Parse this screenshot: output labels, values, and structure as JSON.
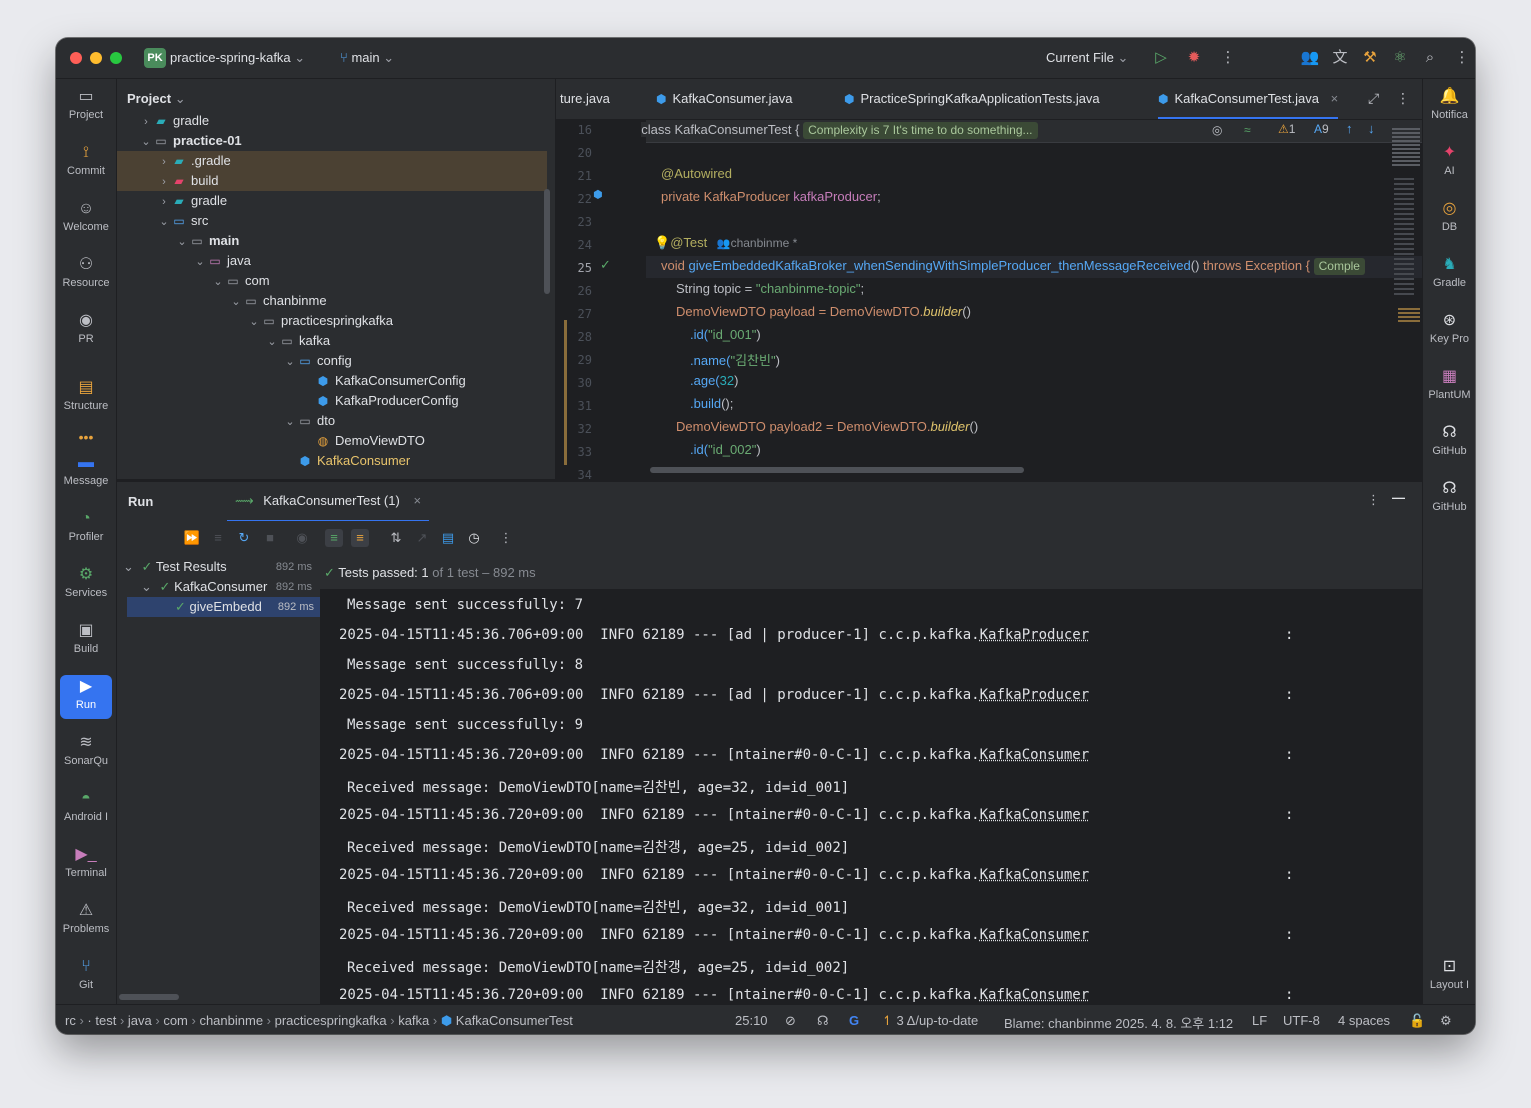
{
  "titlebar": {
    "project_badge": "PK",
    "project_name": "practice-spring-kafka",
    "branch": "main",
    "run_config": "Current File",
    "colors": {
      "close": "#ff5f57",
      "minimize": "#febc2e",
      "zoom": "#28c840"
    }
  },
  "left_tools": [
    {
      "label": "Project",
      "icon": "laptop-icon"
    },
    {
      "label": "Commit",
      "icon": "commit-icon"
    },
    {
      "label": "Welcome",
      "icon": "welcome-icon"
    },
    {
      "label": "Resource",
      "icon": "resource-icon"
    },
    {
      "label": "PR",
      "icon": "github-icon"
    },
    {
      "label": "Structure",
      "icon": "structure-icon"
    },
    {
      "label": "Message",
      "icon": "message-icon"
    },
    {
      "label": "Profiler",
      "icon": "profiler-icon"
    },
    {
      "label": "Services",
      "icon": "services-icon"
    },
    {
      "label": "Build",
      "icon": "build-icon"
    },
    {
      "label": "Run",
      "icon": "run-icon"
    },
    {
      "label": "SonarQu",
      "icon": "sonar-icon"
    },
    {
      "label": "Android I",
      "icon": "android-icon"
    },
    {
      "label": "Terminal",
      "icon": "terminal-icon"
    },
    {
      "label": "Problems",
      "icon": "problems-icon"
    },
    {
      "label": "Git",
      "icon": "git-icon"
    }
  ],
  "right_tools": [
    {
      "label": "Notifica",
      "icon": "bell-icon"
    },
    {
      "label": "AI",
      "icon": "ai-icon"
    },
    {
      "label": "DB",
      "icon": "database-icon"
    },
    {
      "label": "Gradle",
      "icon": "gradle-icon"
    },
    {
      "label": "Key Pro",
      "icon": "key-promoter-icon"
    },
    {
      "label": "PlantUM",
      "icon": "plantuml-icon"
    },
    {
      "label": "GitHub",
      "icon": "copilot-icon"
    },
    {
      "label": "GitHub",
      "icon": "copilot-chat-icon"
    },
    {
      "label": "Layout I",
      "icon": "layout-inspector-icon"
    }
  ],
  "project_panel": {
    "title": "Project",
    "tree": [
      {
        "label": "gradle",
        "depth": 1,
        "chev": "›",
        "icon": "gradle-folder-icon"
      },
      {
        "label": "practice-01",
        "depth": 1,
        "chev": "⌄",
        "icon": "folder-icon",
        "bold": true
      },
      {
        "label": ".gradle",
        "depth": 2,
        "chev": "›",
        "icon": "gradle-folder-icon",
        "selected": true
      },
      {
        "label": "build",
        "depth": 2,
        "chev": "›",
        "icon": "excluded-folder-icon",
        "selected": true
      },
      {
        "label": "gradle",
        "depth": 2,
        "chev": "›",
        "icon": "gradle-folder-icon"
      },
      {
        "label": "src",
        "depth": 2,
        "chev": "⌄",
        "icon": "source-folder-icon"
      },
      {
        "label": "main",
        "depth": 3,
        "chev": "⌄",
        "icon": "module-folder-icon",
        "bold": true
      },
      {
        "label": "java",
        "depth": 4,
        "chev": "⌄",
        "icon": "java-folder-icon"
      },
      {
        "label": "com",
        "depth": 5,
        "chev": "⌄",
        "icon": "folder-icon"
      },
      {
        "label": "chanbinme",
        "depth": 6,
        "chev": "⌄",
        "icon": "folder-icon"
      },
      {
        "label": "practicespringkafka",
        "depth": 7,
        "chev": "⌄",
        "icon": "folder-icon"
      },
      {
        "label": "kafka",
        "depth": 8,
        "chev": "⌄",
        "icon": "folder-icon"
      },
      {
        "label": "config",
        "depth": 9,
        "chev": "⌄",
        "icon": "config-folder-icon"
      },
      {
        "label": "KafkaConsumerConfig",
        "depth": 10,
        "chev": "",
        "icon": "java-class-icon"
      },
      {
        "label": "KafkaProducerConfig",
        "depth": 10,
        "chev": "",
        "icon": "java-class-icon"
      },
      {
        "label": "dto",
        "depth": 9,
        "chev": "⌄",
        "icon": "package-icon"
      },
      {
        "label": "DemoViewDTO",
        "depth": 10,
        "chev": "",
        "icon": "record-icon"
      },
      {
        "label": "KafkaConsumer",
        "depth": 9,
        "chev": "",
        "icon": "java-class-icon",
        "accent": true
      }
    ]
  },
  "editor_tabs": [
    {
      "label": "ture.java",
      "active": false
    },
    {
      "label": "KafkaConsumer.java",
      "active": false
    },
    {
      "label": "PracticeSpringKafkaApplicationTests.java",
      "active": false
    },
    {
      "label": "KafkaConsumerTest.java",
      "active": true
    }
  ],
  "editor": {
    "sticky_line_number": "16",
    "sticky_code": "class KafkaConsumerTest {",
    "sticky_hint": "Complexity is 7 It's time to do something...",
    "warnings": "1",
    "typos": "9",
    "line_numbers": [
      "20",
      "21",
      "22",
      "23",
      "24",
      "25",
      "26",
      "27",
      "28",
      "29",
      "30",
      "31",
      "32",
      "33",
      "34"
    ],
    "current_line": "25",
    "author_hint": "chanbinme *",
    "code": {
      "l21": "@Autowired",
      "l22_kw": "private",
      "l22_type": "KafkaProducer",
      "l22_field": "kafkaProducer",
      "l22_end": ";",
      "l24": "@Test",
      "l25_kw": "void",
      "l25_fn": "giveEmbeddedKafkaBroker_whenSendingWithSimpleProducer_thenMessageReceived",
      "l25_mid": "()",
      "l25_throws": "throws",
      "l25_exc": "Exception {",
      "l25_hint": "Comple",
      "l26_a": "String topic = ",
      "l26_s": "\"chanbinme-topic\"",
      "l26_b": ";",
      "l27_a": "DemoViewDTO payload = DemoViewDTO.",
      "l27_m": "builder",
      "l27_b": "()",
      "l28_m": ".id(",
      "l28_s": "\"id_001\"",
      "l28_b": ")",
      "l29_m": ".name(",
      "l29_s": "\"김찬빈\"",
      "l29_b": ")",
      "l30_m": ".age(",
      "l30_n": "32",
      "l30_b": ")",
      "l31_m": ".build",
      "l31_b": "();",
      "l32_a": "DemoViewDTO payload2 = DemoViewDTO.",
      "l32_m": "builder",
      "l32_b": "()",
      "l33_m": ".id(",
      "l33_s": "\"id_002\"",
      "l33_b": ")"
    }
  },
  "run_panel": {
    "title": "Run",
    "tab_label": "KafkaConsumerTest (1)",
    "status_prefix": "Tests passed:",
    "status_count": "1",
    "status_suffix": "of 1 test",
    "status_time": "– 892 ms",
    "tree": [
      {
        "label": "Test Results",
        "time": "892 ms"
      },
      {
        "label": "KafkaConsumer",
        "time": "892 ms"
      },
      {
        "label": "giveEmbedd",
        "time": "892 ms"
      }
    ],
    "console": [
      {
        "text": "Message sent successfully: 7",
        "kind": "msg"
      },
      {
        "text": "2025-04-15T11:45:36.706+09:00  INFO 62189 --- [ad | producer-1] c.c.p.kafka.",
        "cls": "KafkaProducer",
        "kind": "log"
      },
      {
        "text": "Message sent successfully: 8",
        "kind": "msg"
      },
      {
        "text": "2025-04-15T11:45:36.706+09:00  INFO 62189 --- [ad | producer-1] c.c.p.kafka.",
        "cls": "KafkaProducer",
        "kind": "log"
      },
      {
        "text": "Message sent successfully: 9",
        "kind": "msg"
      },
      {
        "text": "2025-04-15T11:45:36.720+09:00  INFO 62189 --- [ntainer#0-0-C-1] c.c.p.kafka.",
        "cls": "KafkaConsumer",
        "kind": "log"
      },
      {
        "text": "Received message: DemoViewDTO[name=김찬빈, age=32, id=id_001]",
        "kind": "msg"
      },
      {
        "text": "2025-04-15T11:45:36.720+09:00  INFO 62189 --- [ntainer#0-0-C-1] c.c.p.kafka.",
        "cls": "KafkaConsumer",
        "kind": "log"
      },
      {
        "text": "Received message: DemoViewDTO[name=김찬갱, age=25, id=id_002]",
        "kind": "msg"
      },
      {
        "text": "2025-04-15T11:45:36.720+09:00  INFO 62189 --- [ntainer#0-0-C-1] c.c.p.kafka.",
        "cls": "KafkaConsumer",
        "kind": "log"
      },
      {
        "text": "Received message: DemoViewDTO[name=김찬빈, age=32, id=id_001]",
        "kind": "msg"
      },
      {
        "text": "2025-04-15T11:45:36.720+09:00  INFO 62189 --- [ntainer#0-0-C-1] c.c.p.kafka.",
        "cls": "KafkaConsumer",
        "kind": "log"
      },
      {
        "text": "Received message: DemoViewDTO[name=김찬갱, age=25, id=id_002]",
        "kind": "msg"
      },
      {
        "text": "2025-04-15T11:45:36.720+09:00  INFO 62189 --- [ntainer#0-0-C-1] c.c.p.kafka.",
        "cls": "KafkaConsumer",
        "kind": "log"
      }
    ],
    "colon": ":"
  },
  "statusbar": {
    "breadcrumb": [
      "rc",
      "·",
      "test",
      "java",
      "com",
      "chanbinme",
      "practicespringkafka",
      "kafka",
      "KafkaConsumerTest"
    ],
    "position": "25:10",
    "vcs": "3 Δ/up-to-date",
    "blame": "Blame: chanbinme 2025. 4. 8. 오후 1:12",
    "line_sep": "LF",
    "encoding": "UTF-8",
    "indent": "4 spaces"
  }
}
